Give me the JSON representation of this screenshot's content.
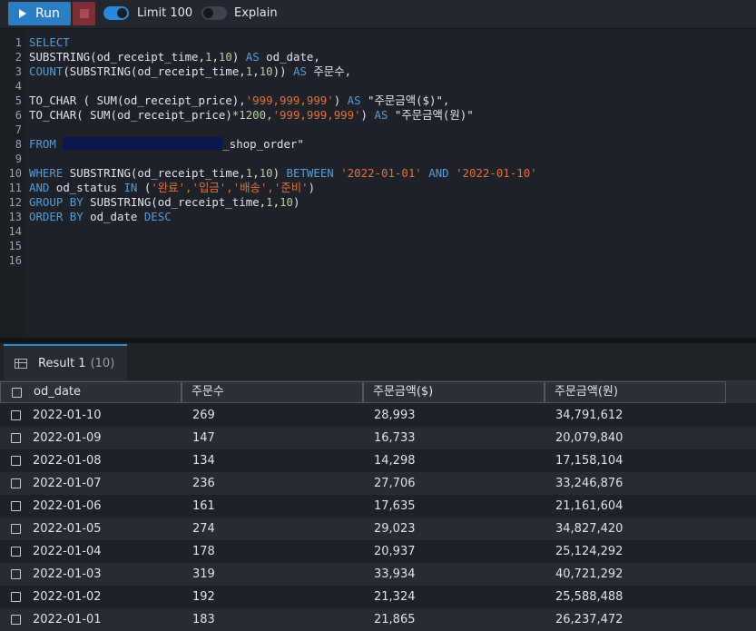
{
  "toolbar": {
    "run_label": "Run",
    "limit_label": "Limit 100",
    "limit_enabled": true,
    "explain_label": "Explain",
    "explain_enabled": false
  },
  "editor": {
    "line_numbers": [
      "1",
      "2",
      "3",
      "4",
      "5",
      "6",
      "7",
      "8",
      "9",
      "10",
      "11",
      "12",
      "13",
      "14",
      "15",
      "16"
    ],
    "lines": {
      "l1_select": "SELECT",
      "l2_fn": "SUBSTRING",
      "l2_args": "(od_receipt_time,",
      "l2_n1": "1",
      "l2_comma": ",",
      "l2_n2": "10",
      "l2_close": ")",
      "l2_as": "AS",
      "l2_alias": "od_date,",
      "l3_count": "COUNT",
      "l3_open": "(",
      "l3_fn": "SUBSTRING",
      "l3_args": "(od_receipt_time,",
      "l3_n1": "1",
      "l3_comma": ",",
      "l3_n2": "10",
      "l3_close": "))",
      "l3_as": "AS",
      "l3_alias": "주문수,",
      "l5_fn": "TO_CHAR ( SUM(od_receipt_price),",
      "l5_fmt": "'999,999,999'",
      "l5_close": ")",
      "l5_as": "AS",
      "l5_alias": "\"주문금액($)\",",
      "l6_fn": "TO_CHAR( SUM(od_receipt_price)",
      "l6_mul": "*1200,",
      "l6_fmt": "'999,999,999'",
      "l6_close": ")",
      "l6_as": "AS",
      "l6_alias": "\"주문금액(원)\"",
      "l8_from": "FROM",
      "l8_table": "_shop_order\"",
      "l10_where": "WHERE",
      "l10_fn": "SUBSTRING(od_receipt_time,",
      "l10_n1": "1",
      "l10_comma": ",",
      "l10_n2": "10",
      "l10_close": ")",
      "l10_between": "BETWEEN",
      "l10_d1": "'2022-01-01'",
      "l10_and": "AND",
      "l10_d2": "'2022-01-10'",
      "l11_and": "AND",
      "l11_col": "od_status",
      "l11_in": "IN",
      "l11_open": "(",
      "l11_vals": "'완료','입금','배송','준비'",
      "l11_close": ")",
      "l12_group": "GROUP BY",
      "l12_fn": "SUBSTRING(od_receipt_time,",
      "l12_n1": "1",
      "l12_comma": ",",
      "l12_n2": "10",
      "l12_close": ")",
      "l13_order": "ORDER BY",
      "l13_col": "od_date",
      "l13_desc": "DESC"
    }
  },
  "results": {
    "tab_label": "Result 1",
    "tab_count": "(10)",
    "columns": [
      "od_date",
      "주문수",
      "주문금액($)",
      "주문금액(원)"
    ],
    "rows": [
      [
        "2022-01-10",
        "269",
        "28,993",
        "34,791,612"
      ],
      [
        "2022-01-09",
        "147",
        "16,733",
        "20,079,840"
      ],
      [
        "2022-01-08",
        "134",
        "14,298",
        "17,158,104"
      ],
      [
        "2022-01-07",
        "236",
        "27,706",
        "33,246,876"
      ],
      [
        "2022-01-06",
        "161",
        "17,635",
        "21,161,604"
      ],
      [
        "2022-01-05",
        "274",
        "29,023",
        "34,827,420"
      ],
      [
        "2022-01-04",
        "178",
        "20,937",
        "25,124,292"
      ],
      [
        "2022-01-03",
        "319",
        "33,934",
        "40,721,292"
      ],
      [
        "2022-01-02",
        "192",
        "21,324",
        "25,588,488"
      ],
      [
        "2022-01-01",
        "183",
        "21,865",
        "26,237,472"
      ]
    ]
  },
  "colors": {
    "run_button": "#2b7ec4",
    "stop_button": "#7c2f36",
    "keyword": "#569cd6",
    "number": "#b5cea8",
    "string": "#e0703e",
    "accent": "#2b87d8"
  }
}
